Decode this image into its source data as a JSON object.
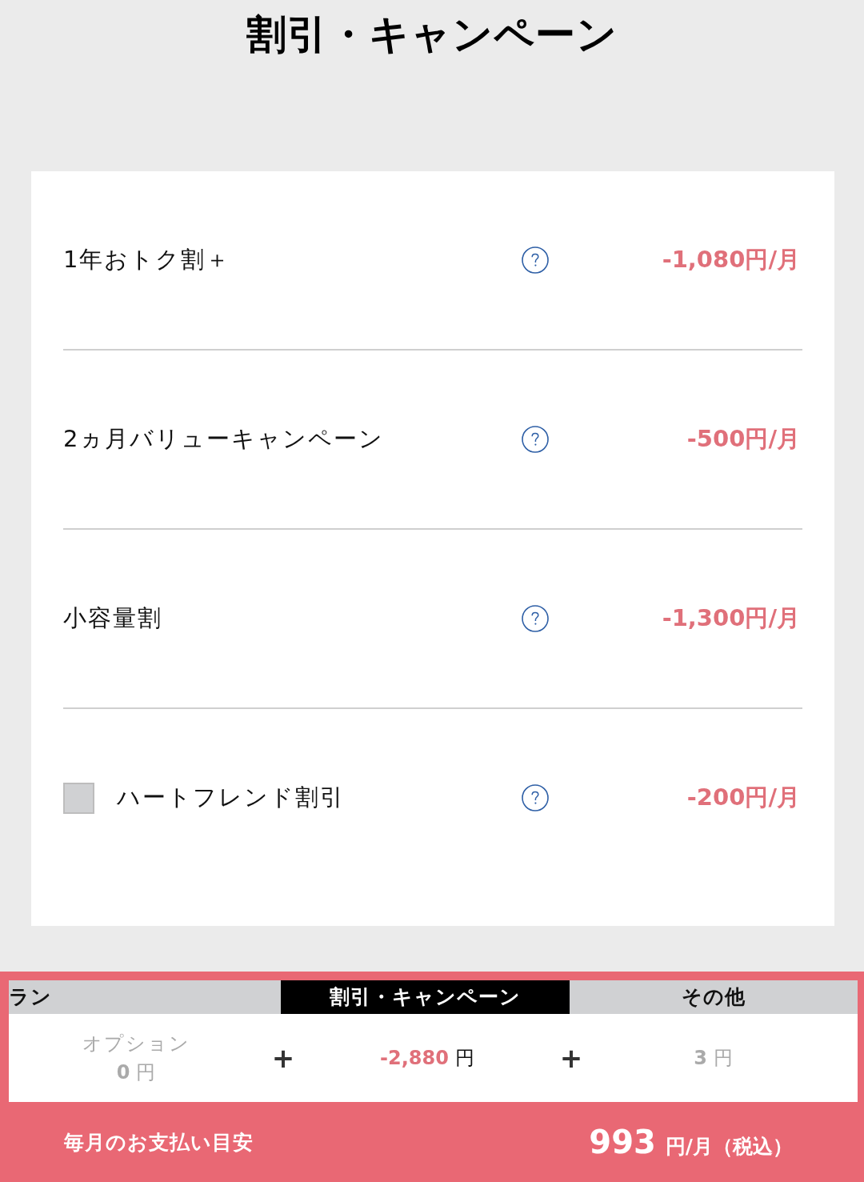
{
  "page_title": "割引・キャンペーン",
  "discounts": [
    {
      "kind": "plain",
      "label": "1年おトク割＋",
      "price": "-1,080円/月"
    },
    {
      "kind": "plain",
      "label": "2ヵ月バリューキャンペーン",
      "price": "-500円/月"
    },
    {
      "kind": "plain",
      "label": "小容量割",
      "price": "-1,300円/月"
    },
    {
      "kind": "checkbox",
      "checked": false,
      "label": "ハートフレンド割引",
      "price": "-200円/月"
    }
  ],
  "summary": {
    "tabs": [
      {
        "label": "ラン",
        "selected": false
      },
      {
        "label": "割引・キャンペーン",
        "selected": true
      },
      {
        "label": "その他",
        "selected": false
      }
    ],
    "items": [
      {
        "caption": "オプション",
        "amount": "0",
        "unit": "円"
      },
      {
        "amount": "-2,880",
        "unit": "円"
      },
      {
        "amount": "3",
        "unit": "円"
      }
    ],
    "operators": [
      "+",
      "+"
    ],
    "total": {
      "label": "毎月のお支払い目安",
      "amount": "993",
      "unit": "円/月（税込）"
    }
  }
}
